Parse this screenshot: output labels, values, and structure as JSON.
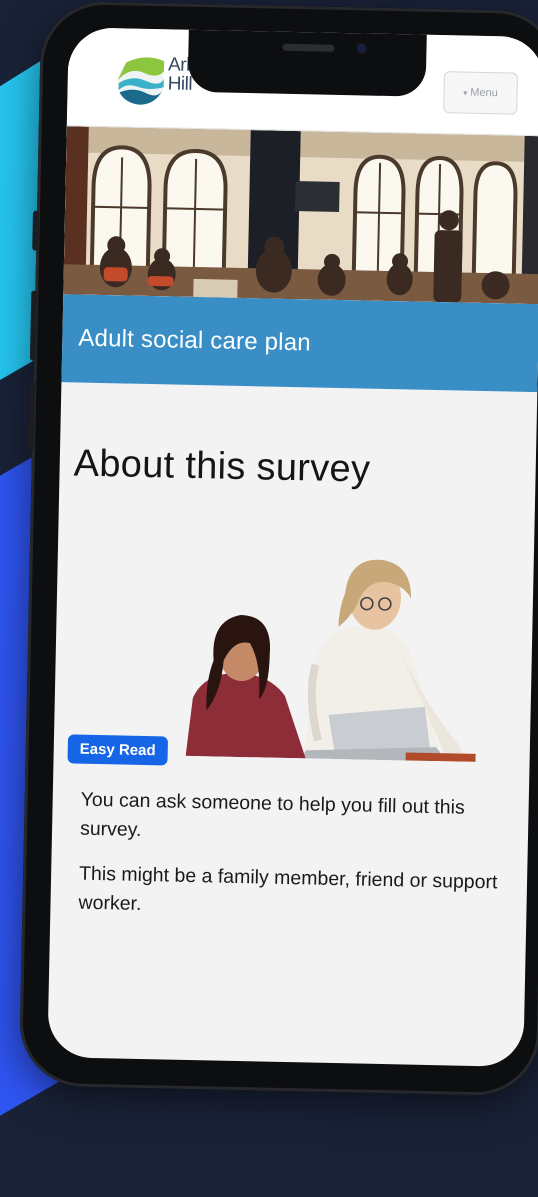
{
  "header": {
    "logo_line1": "Arlen",
    "logo_line2": "Hill",
    "menu_label": "Menu"
  },
  "banner": {
    "title": "Adult social care plan"
  },
  "page": {
    "title": "About this survey",
    "badge": "Easy Read",
    "paragraphs": [
      "You can ask someone to help you fill out this survey.",
      "This might be a family member, friend or support worker."
    ]
  },
  "colors": {
    "banner": "#3a8ec6",
    "badge": "#1565e6",
    "background": "#1a2238",
    "accent_cyan": "#25c4ee",
    "accent_blue": "#2f55f2"
  },
  "icons": [
    "logo-icon",
    "chevron-down-icon"
  ]
}
